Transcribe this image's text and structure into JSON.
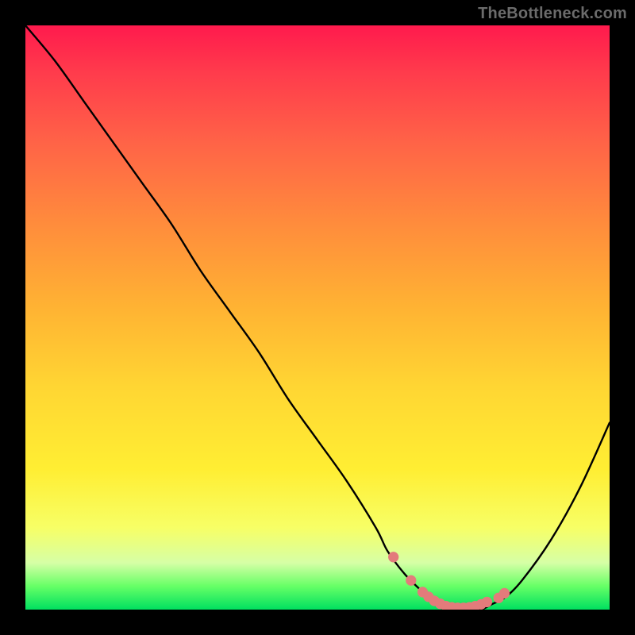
{
  "watermark": "TheBottleneck.com",
  "chart_data": {
    "type": "line",
    "title": "",
    "xlabel": "",
    "ylabel": "",
    "xlim": [
      0,
      100
    ],
    "ylim": [
      0,
      100
    ],
    "grid": false,
    "legend": false,
    "series": [
      {
        "name": "bottleneck-curve",
        "color": "#000000",
        "x": [
          0,
          5,
          10,
          15,
          20,
          25,
          30,
          35,
          40,
          45,
          50,
          55,
          60,
          62,
          65,
          68,
          70,
          72,
          74,
          76,
          78,
          80,
          82,
          85,
          90,
          95,
          100
        ],
        "values": [
          100,
          94,
          87,
          80,
          73,
          66,
          58,
          51,
          44,
          36,
          29,
          22,
          14,
          10,
          6,
          3,
          1,
          0,
          0,
          0,
          0,
          1,
          2,
          5,
          12,
          21,
          32
        ]
      }
    ],
    "markers": {
      "name": "valley-dots",
      "color": "#e37b7b",
      "radius_pct": 0.9,
      "x": [
        63,
        66,
        68,
        69,
        70,
        71,
        72,
        73,
        74,
        75,
        76,
        77,
        78,
        79,
        81,
        82
      ],
      "values": [
        9,
        5,
        3,
        2.2,
        1.5,
        1.0,
        0.6,
        0.4,
        0.3,
        0.3,
        0.4,
        0.6,
        0.9,
        1.3,
        2.0,
        2.8
      ]
    },
    "background_gradient": {
      "top": "#ff1a4d",
      "mid": "#ffd633",
      "bottom": "#00e060"
    }
  }
}
